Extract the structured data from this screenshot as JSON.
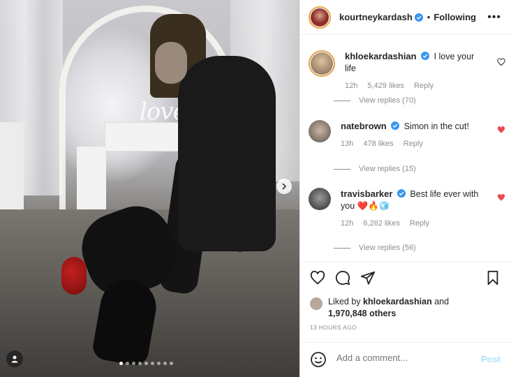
{
  "post": {
    "author": "kourtneykardash",
    "follow_status": "Following",
    "separator": "•",
    "more_icon": "more-horizontal-icon"
  },
  "photo": {
    "sign_text": "love",
    "carousel_count": 9,
    "carousel_active": 0
  },
  "comments": [
    {
      "user": "khloekardashian",
      "text": "I love your life",
      "time": "12h",
      "likes": "5,429 likes",
      "reply": "Reply",
      "view_replies": "View replies (70)",
      "liked": false
    },
    {
      "user": "natebrown",
      "text": "Simon in the cut!",
      "time": "13h",
      "likes": "478 likes",
      "reply": "Reply",
      "view_replies": "View replies (15)",
      "liked": true
    },
    {
      "user": "travisbarker",
      "text": "Best life ever with you ❤️🔥🧊",
      "time": "12h",
      "likes": "6,262 likes",
      "reply": "Reply",
      "view_replies": "View replies (56)",
      "liked": true
    }
  ],
  "likes_summary": {
    "prefix": "Liked by",
    "user": "khloekardashian",
    "and": "and",
    "others": "1,970,848 others"
  },
  "timestamp": "13 HOURS AGO",
  "add_comment": {
    "placeholder": "Add a comment...",
    "post_label": "Post"
  },
  "colors": {
    "verified": "#3897f0",
    "liked_heart": "#ed4956",
    "post_disabled": "#b2dffc",
    "meta_gray": "#8e8e8e"
  }
}
